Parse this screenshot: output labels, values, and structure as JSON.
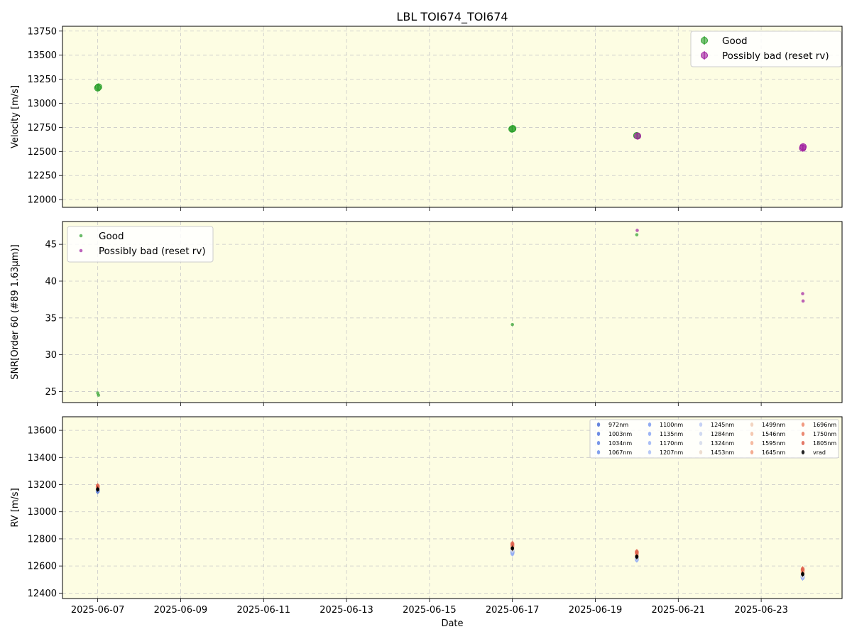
{
  "title": "LBL TOI674_TOI674",
  "colors": {
    "good": "#2ca02c",
    "bad": "#a020a0",
    "background": "#fdfde3",
    "grid": "#c8c8c8"
  },
  "x_axis": {
    "label": "Date",
    "ticks": [
      "2025-06-07",
      "2025-06-09",
      "2025-06-11",
      "2025-06-13",
      "2025-06-15",
      "2025-06-17",
      "2025-06-19",
      "2025-06-21",
      "2025-06-23"
    ],
    "range": [
      "2025-06-06.15",
      "2025-06-24.95"
    ]
  },
  "chart_data": [
    {
      "type": "scatter",
      "ylabel": "Velocity [m/s]",
      "ylim": [
        11920,
        13800
      ],
      "yticks": [
        12000,
        12250,
        12500,
        12750,
        13000,
        13250,
        13500,
        13750
      ],
      "legend_position": "top-right",
      "grid": true,
      "series": [
        {
          "name": "Good",
          "role": "good",
          "errorbars": true,
          "points": [
            {
              "date": "2025-06-07.00",
              "y": 13160
            },
            {
              "date": "2025-06-07.02",
              "y": 13170
            },
            {
              "date": "2025-06-16.99",
              "y": 12733
            },
            {
              "date": "2025-06-17.01",
              "y": 12737
            },
            {
              "date": "2025-06-20.00",
              "y": 12665
            }
          ]
        },
        {
          "name": "Possibly bad (reset rv)",
          "role": "bad",
          "errorbars": true,
          "points": [
            {
              "date": "2025-06-20.02",
              "y": 12660
            },
            {
              "date": "2025-06-24.00",
              "y": 12535
            },
            {
              "date": "2025-06-24.01",
              "y": 12548
            }
          ]
        }
      ]
    },
    {
      "type": "scatter",
      "ylabel": "SNR[Order 60 (#89 1.63μm)]",
      "ylim": [
        23.5,
        48.1
      ],
      "yticks": [
        25,
        30,
        35,
        40,
        45
      ],
      "legend_position": "top-left",
      "grid": true,
      "series": [
        {
          "name": "Good",
          "role": "good",
          "points": [
            {
              "date": "2025-06-07.00",
              "y": 24.8
            },
            {
              "date": "2025-06-07.02",
              "y": 24.5
            },
            {
              "date": "2025-06-17.00",
              "y": 34.1
            },
            {
              "date": "2025-06-20.00",
              "y": 46.3
            }
          ]
        },
        {
          "name": "Possibly bad (reset rv)",
          "role": "bad",
          "points": [
            {
              "date": "2025-06-20.01",
              "y": 46.9
            },
            {
              "date": "2025-06-24.00",
              "y": 38.3
            },
            {
              "date": "2025-06-24.01",
              "y": 37.3
            }
          ]
        }
      ]
    },
    {
      "type": "scatter",
      "ylabel": "RV [m/s]",
      "xlabel": "Date",
      "ylim": [
        12360,
        13700
      ],
      "yticks": [
        12400,
        12600,
        12800,
        13000,
        13200,
        13400,
        13600
      ],
      "legend_position": "top-right",
      "grid": true,
      "epochs": [
        "2025-06-07.00",
        "2025-06-17.00",
        "2025-06-20.00",
        "2025-06-24.00"
      ],
      "series": [
        {
          "name": "972nm",
          "color": "#4a6ed8",
          "values": [
            13150,
            12700,
            12650,
            12515
          ]
        },
        {
          "name": "1003nm",
          "color": "#5578e0",
          "values": [
            13155,
            12705,
            12652,
            12520
          ]
        },
        {
          "name": "1034nm",
          "color": "#6284e6",
          "values": [
            13158,
            12710,
            12655,
            12522
          ]
        },
        {
          "name": "1067nm",
          "color": "#6f90eb",
          "values": [
            13160,
            12695,
            12648,
            12518
          ]
        },
        {
          "name": "1100nm",
          "color": "#7e9cf0",
          "values": [
            13162,
            12712,
            12658,
            12525
          ]
        },
        {
          "name": "1135nm",
          "color": "#8da8f3",
          "values": [
            13165,
            12708,
            12650,
            12520
          ]
        },
        {
          "name": "1170nm",
          "color": "#9cb4f5",
          "values": [
            13163,
            12690,
            12645,
            12512
          ]
        },
        {
          "name": "1207nm",
          "color": "#abbff6",
          "values": [
            13168,
            12718,
            12660,
            12528
          ]
        },
        {
          "name": "1245nm",
          "color": "#bbc9f3",
          "values": [
            13170,
            12720,
            12662,
            12530
          ]
        },
        {
          "name": "1284nm",
          "color": "#c8d2ef",
          "values": [
            13166,
            12715,
            12658,
            12526
          ]
        },
        {
          "name": "1324nm",
          "color": "#d4d9ea",
          "values": [
            13172,
            12722,
            12665,
            12532
          ]
        },
        {
          "name": "1453nm",
          "color": "#ead7c8",
          "values": [
            13175,
            12728,
            12670,
            12540
          ]
        },
        {
          "name": "1499nm",
          "color": "#f0ccb6",
          "values": [
            13178,
            12732,
            12675,
            12545
          ]
        },
        {
          "name": "1546nm",
          "color": "#f3bea3",
          "values": [
            13180,
            12738,
            12680,
            12550
          ]
        },
        {
          "name": "1595nm",
          "color": "#f4ae90",
          "values": [
            13182,
            12742,
            12685,
            12555
          ]
        },
        {
          "name": "1645nm",
          "color": "#f29d7e",
          "values": [
            13185,
            12748,
            12690,
            12560
          ]
        },
        {
          "name": "1696nm",
          "color": "#ee8a6c",
          "values": [
            13178,
            12752,
            12695,
            12568
          ]
        },
        {
          "name": "1750nm",
          "color": "#e8765b",
          "values": [
            13188,
            12758,
            12700,
            12572
          ]
        },
        {
          "name": "1805nm",
          "color": "#de604c",
          "values": [
            13190,
            12765,
            12705,
            12578
          ]
        },
        {
          "name": "vrad",
          "color": "#000000",
          "values": [
            13165,
            12730,
            12668,
            12540
          ]
        }
      ]
    }
  ]
}
